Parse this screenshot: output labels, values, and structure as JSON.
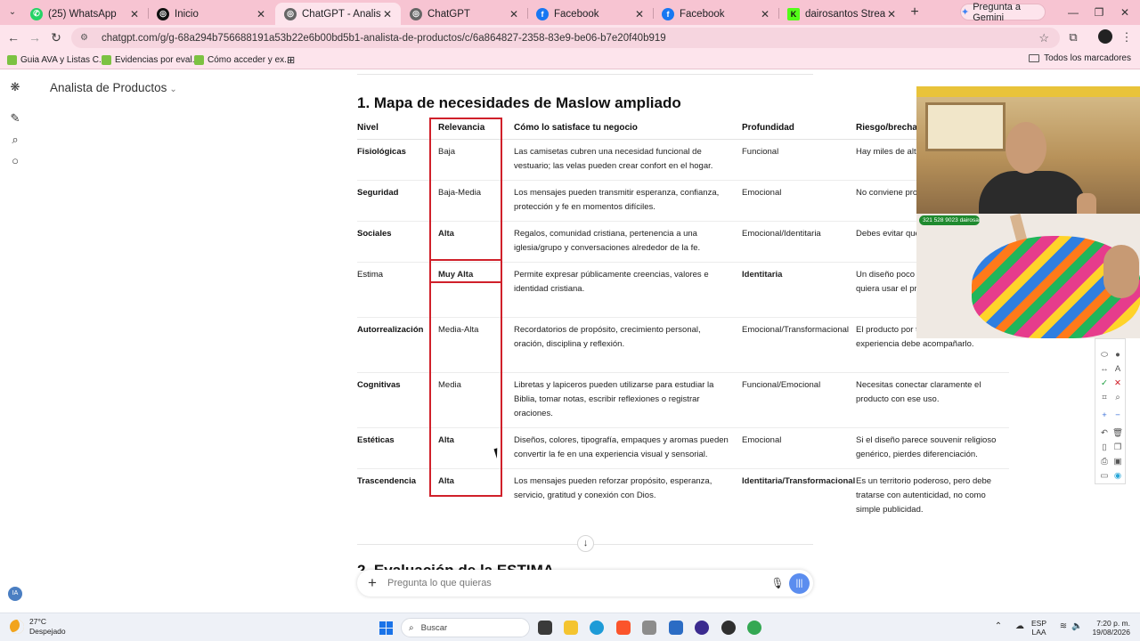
{
  "tabs": [
    {
      "title": "(25) WhatsApp",
      "icon": "whatsapp-icon",
      "color": "#25d366",
      "active": false
    },
    {
      "title": "Inicio",
      "icon": "chatgpt-icon",
      "color": "#111111",
      "active": false
    },
    {
      "title": "ChatGPT - Analista de Prod",
      "icon": "chatgpt-icon",
      "color": "#666666",
      "active": true
    },
    {
      "title": "ChatGPT",
      "icon": "chatgpt-icon",
      "color": "#666666",
      "active": false
    },
    {
      "title": "Facebook",
      "icon": "facebook-icon",
      "color": "#1877f2",
      "active": false
    },
    {
      "title": "Facebook",
      "icon": "facebook-icon",
      "color": "#1877f2",
      "active": false
    },
    {
      "title": "dairosantos Stream - Watc",
      "icon": "kick-icon",
      "color": "#53fc18",
      "active": false
    }
  ],
  "gemini": {
    "label": "Pregunta a Gemini"
  },
  "address": {
    "url": "chatgpt.com/g/g-68a294b756688191a53b22e6b00bd5b1-analista-de-productos/c/6a864827-2358-83e9-be06-b7e20f40b919"
  },
  "bookmarks": {
    "items": [
      {
        "label": "Guia AVA y Listas C..."
      },
      {
        "label": "Evidencias por eval..."
      },
      {
        "label": "Cómo acceder y ex..."
      }
    ],
    "all_label": "Todos los marcadores"
  },
  "gpt": {
    "name": "Analista de Productos"
  },
  "rail": {
    "avatar": "IA"
  },
  "section": {
    "title": "1. Mapa de necesidades de Maslow ampliado"
  },
  "table": {
    "headers": [
      "Nivel",
      "Relevancia",
      "Cómo lo satisface tu negocio",
      "Profundidad",
      "Riesgo/brecha"
    ],
    "rows": [
      {
        "nivel": "Fisiológicas",
        "relevancia": "Baja",
        "como": "Las camisetas cubren una necesidad funcional de vestuario; las velas pueden crear confort en el hogar.",
        "profundidad": "Funcional",
        "riesgo": "Hay miles de alt No es tu diferen"
      },
      {
        "nivel": "Seguridad",
        "relevancia": "Baja-Media",
        "como": "Los mensajes pueden transmitir esperanza, confianza, protección y fe en momentos difíciles.",
        "profundidad": "Emocional",
        "riesgo": "No conviene pro \"protege\" literal"
      },
      {
        "nivel": "Sociales",
        "relevancia": "Alta",
        "como": "Regalos, comunidad cristiana, pertenencia a una iglesia/grupo y conversaciones alrededor de la fe.",
        "profundidad": "Emocional/Identitaria",
        "riesgo": "Debes evitar que genérico o exclu"
      },
      {
        "nivel": "Estima",
        "relevancia": "Muy Alta",
        "como": "Permite expresar públicamente creencias, valores e identidad cristiana.",
        "profundidad": "Identitaria",
        "riesgo": "Un diseño poco que alguien com quiera usar el pr"
      },
      {
        "nivel": "Autorrealización",
        "relevancia": "Media-Alta",
        "como": "Recordatorios de propósito, crecimiento personal, oración, disciplina y reflexión.",
        "profundidad": "Emocional/Transformacional",
        "riesgo": "El producto por transformación; la experiencia debe acompañarlo."
      },
      {
        "nivel": "Cognitivas",
        "relevancia": "Media",
        "como": "Libretas y lapiceros pueden utilizarse para estudiar la Biblia, tomar notas, escribir reflexiones o registrar oraciones.",
        "profundidad": "Funcional/Emocional",
        "riesgo": "Necesitas conectar claramente el producto con ese uso."
      },
      {
        "nivel": "Estéticas",
        "relevancia": "Alta",
        "como": "Diseños, colores, tipografía, empaques y aromas pueden convertir la fe en una experiencia visual y sensorial.",
        "profundidad": "Emocional",
        "riesgo": "Si el diseño parece souvenir religioso genérico, pierdes diferenciación."
      },
      {
        "nivel": "Trascendencia",
        "relevancia": "Alta",
        "como": "Los mensajes pueden reforzar propósito, esperanza, servicio, gratitud y conexión con Dios.",
        "profundidad": "Identitaria/Transformacional",
        "riesgo": "Es un territorio poderoso, pero debe tratarse con autenticidad, no como simple publicidad."
      }
    ]
  },
  "next_section": {
    "title": "2. Evaluación de la ESTIMA"
  },
  "composer": {
    "placeholder": "Pregunta lo que quieras"
  },
  "webcam": {
    "badge": "321 528 9023 dairosantos"
  },
  "taskbar": {
    "weather_temp": "27°C",
    "weather_desc": "Despejado",
    "search_label": "Buscar",
    "lang_1": "ESP",
    "lang_2": "LAA",
    "time": "7:20 p. m.",
    "date": "19/08/2026"
  }
}
